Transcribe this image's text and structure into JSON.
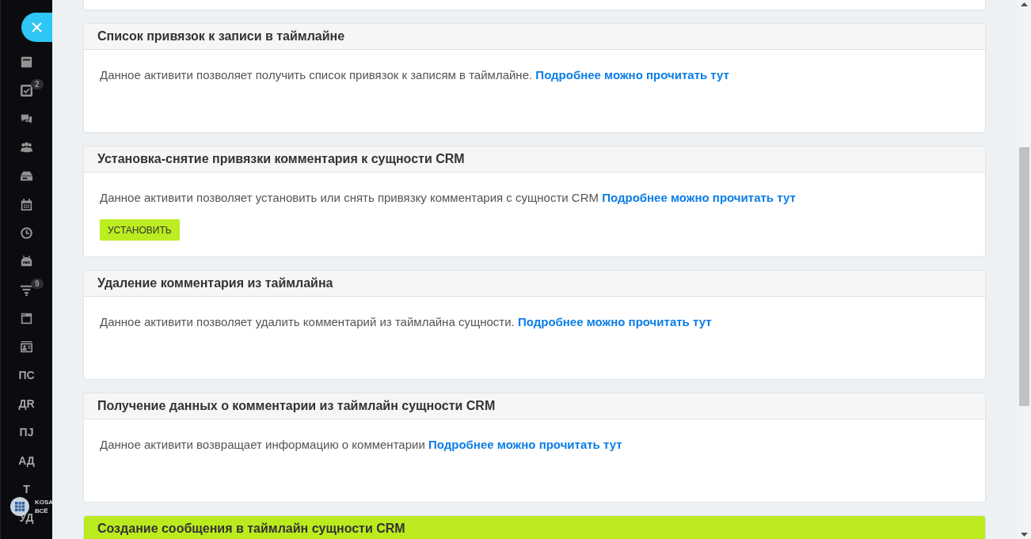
{
  "sidebar": {
    "items": [
      {
        "kind": "icon"
      },
      {
        "kind": "icon",
        "badge": "2"
      },
      {
        "kind": "icon"
      },
      {
        "kind": "icon"
      },
      {
        "kind": "icon"
      },
      {
        "kind": "icon"
      },
      {
        "kind": "icon"
      },
      {
        "kind": "icon"
      },
      {
        "kind": "icon",
        "badge": "9"
      },
      {
        "kind": "icon"
      },
      {
        "kind": "icon"
      },
      {
        "kind": "text",
        "label": "ПС"
      },
      {
        "kind": "text",
        "label": "ДR"
      },
      {
        "kind": "text",
        "label": "ПЈ"
      },
      {
        "kind": "text",
        "label": "АД"
      },
      {
        "kind": "text",
        "label": "Т"
      },
      {
        "kind": "text",
        "label": "УД"
      }
    ],
    "logo": {
      "lines": [
        "KOSA",
        "ВСЁ"
      ]
    }
  },
  "cards": [
    {
      "title": "Список привязок к записи в таймлайне",
      "description": "Данное активити позволяет получить список привязок к записям в таймлайне.",
      "link": "Подробнее можно прочитать тут",
      "highlighted": false
    },
    {
      "title": "Установка-снятие привязки комментария к сущности CRM",
      "description": "Данное активити позволяет установить или снять привязку комментария с сущности CRM",
      "link": "Подробнее можно прочитать тут",
      "button": "УСТАНОВИТЬ",
      "highlighted": false
    },
    {
      "title": "Удаление комментария из таймлайна",
      "description": "Данное активити позволяет удалить комментарий из таймлайна сущности.",
      "link": "Подробнее можно прочитать тут",
      "highlighted": false
    },
    {
      "title": "Получение данных о комментарии из таймлайн сущности CRM",
      "description": "Данное активити возвращает информацию о комментарии",
      "link": "Подробнее можно прочитать тут",
      "highlighted": false
    },
    {
      "title": "Создание сообщения в таймлайн сущности CRM",
      "highlighted": true
    }
  ]
}
